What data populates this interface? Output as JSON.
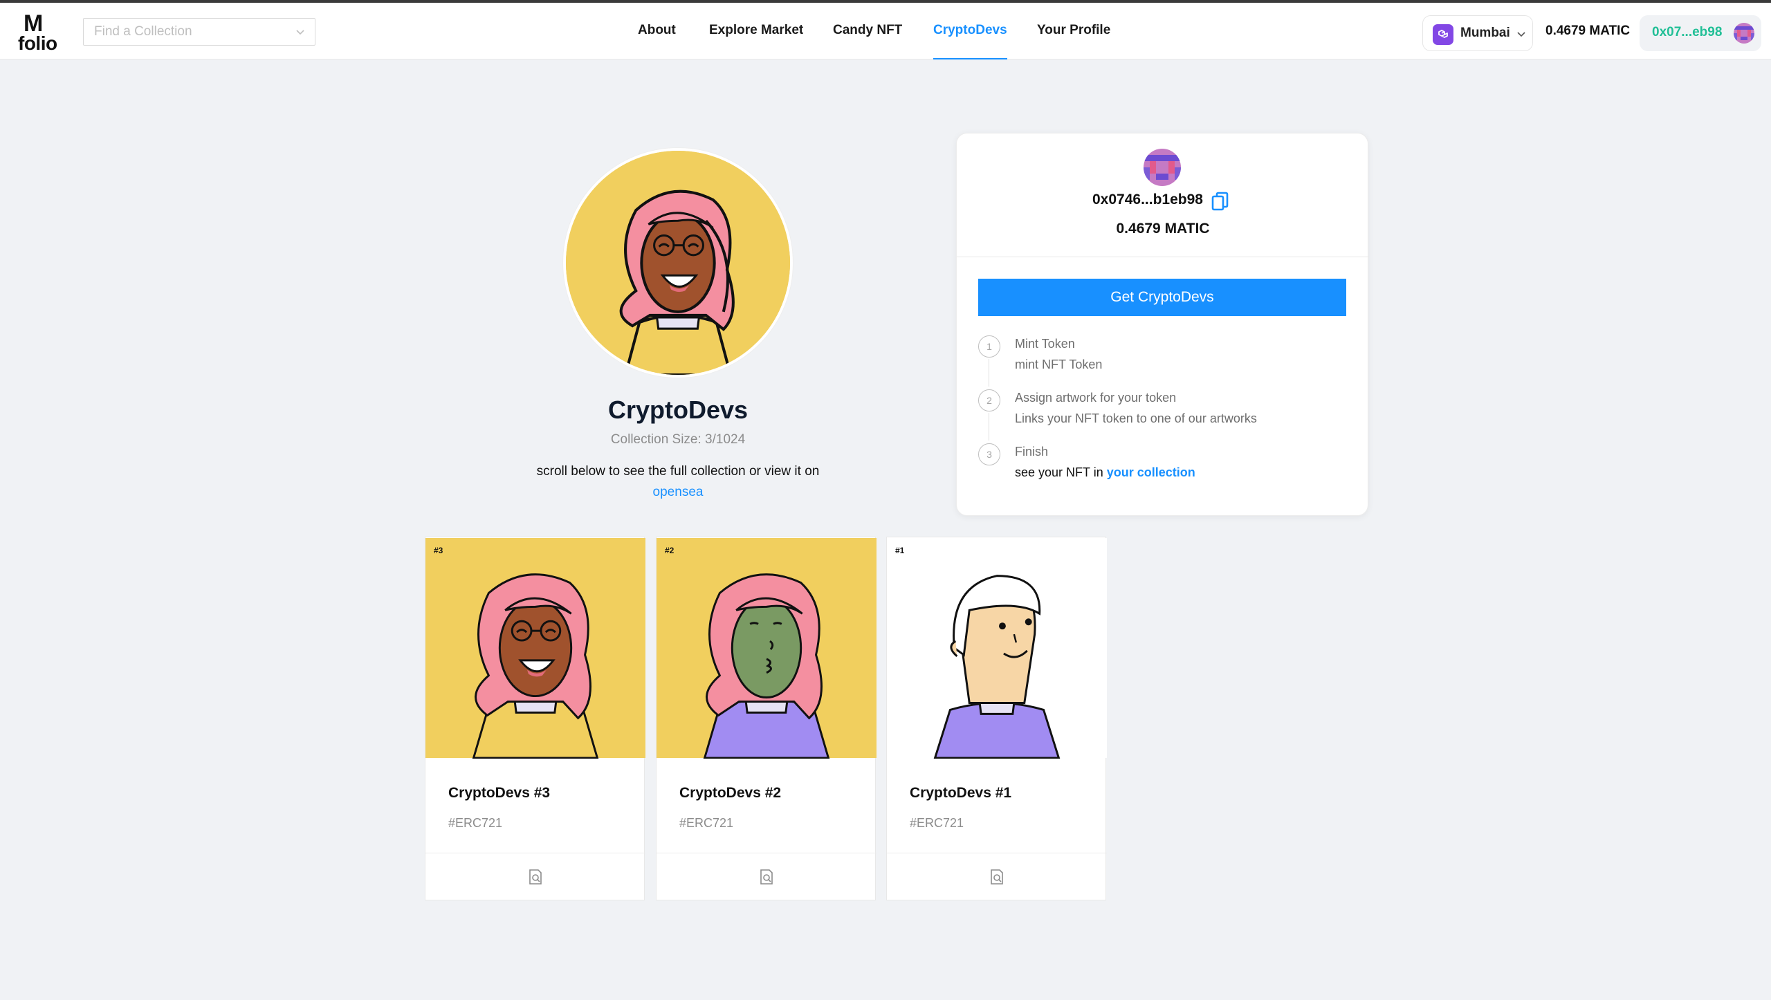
{
  "header": {
    "logo_m": "M",
    "logo_text": "folio",
    "search_placeholder": "Find a Collection",
    "nav": [
      {
        "label": "About"
      },
      {
        "label": "Explore Market"
      },
      {
        "label": "Candy NFT"
      },
      {
        "label": "CryptoDevs",
        "active": true
      },
      {
        "label": "Your Profile"
      }
    ],
    "network": {
      "label": "Mumbai",
      "icon": "polygon-icon"
    },
    "balance": "0.4679 MATIC",
    "account_address": "0x07...eb98"
  },
  "collection": {
    "title": "CryptoDevs",
    "size_label": "Collection Size: 3/1024",
    "description": "scroll below to see the full collection or view it on",
    "description_link": "opensea"
  },
  "mint_card": {
    "address": "0x0746...b1eb98",
    "balance": "0.4679 MATIC",
    "button_label": "Get CryptoDevs",
    "steps": [
      {
        "number": "1",
        "title": "Mint Token",
        "description": "mint NFT Token"
      },
      {
        "number": "2",
        "title": "Assign artwork for your token",
        "description": "Links your NFT token to one of our artworks"
      },
      {
        "number": "3",
        "title": "Finish",
        "description": "see your NFT in",
        "link": "your collection"
      }
    ]
  },
  "cards": [
    {
      "tag": "#3",
      "name": "CryptoDevs #3",
      "standard": "#ERC721",
      "action_icon": "file-search-icon"
    },
    {
      "tag": "#2",
      "name": "CryptoDevs #2",
      "standard": "#ERC721",
      "action_icon": "file-search-icon"
    },
    {
      "tag": "#1",
      "name": "CryptoDevs #1",
      "standard": "#ERC721",
      "action_icon": "file-search-icon"
    }
  ],
  "colors": {
    "accent": "#1890ff",
    "account_text": "#21bf96",
    "polygon": "#8247e5",
    "card_yellow": "#f1cf5e"
  }
}
